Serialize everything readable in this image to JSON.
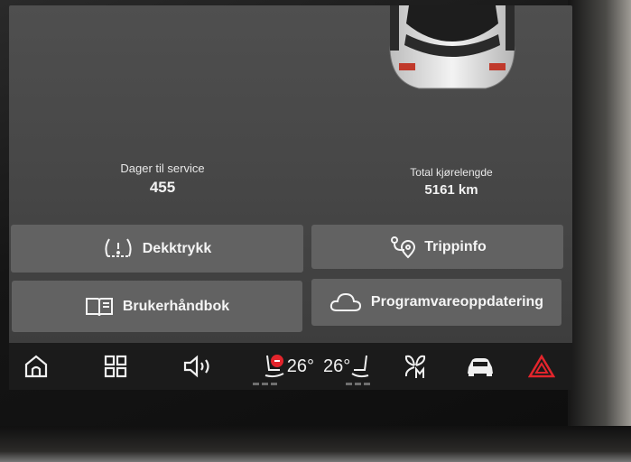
{
  "stats": {
    "service_label": "Dager til service",
    "service_value": "455",
    "odometer_label": "Total kjørelengde",
    "odometer_value": "5161 km"
  },
  "buttons": {
    "tire_pressure": "Dekktrykk",
    "trip_info": "Trippinfo",
    "owners_manual": "Brukerhåndbok",
    "software_update": "Programvareoppdatering"
  },
  "taskbar": {
    "driver_temp": "26°",
    "passenger_temp": "26°",
    "icons": [
      "home-icon",
      "apps-grid-icon",
      "volume-icon",
      "seat-heat-driver-icon",
      "seat-heat-passenger-icon",
      "fan-manual-icon",
      "car-icon",
      "hazard-icon"
    ]
  },
  "colors": {
    "hazard": "#e3252c",
    "seat_alert": "#e3252c"
  }
}
